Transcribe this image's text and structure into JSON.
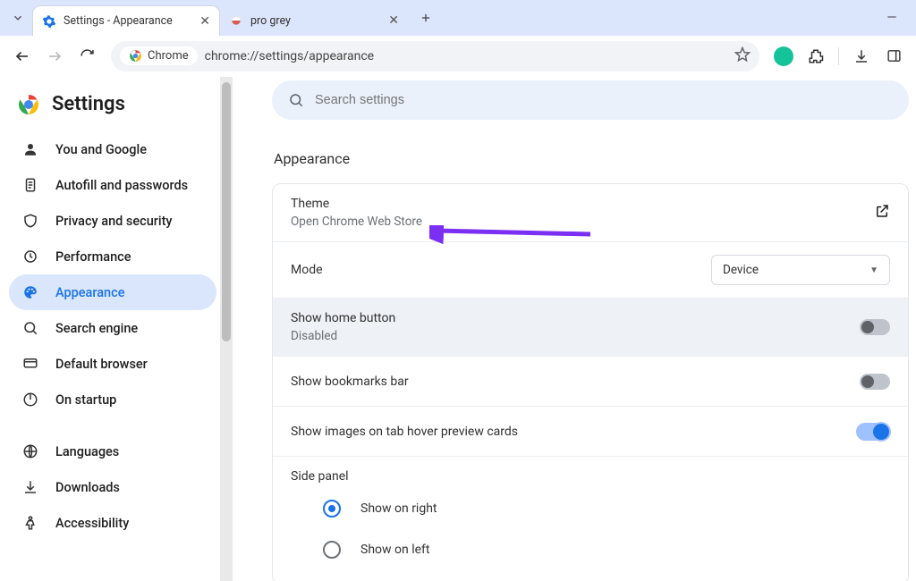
{
  "tabs": [
    {
      "title": "Settings - Appearance",
      "active": true
    },
    {
      "title": "pro grey",
      "active": false
    }
  ],
  "omnibox": {
    "chip_label": "Chrome",
    "url": "chrome://settings/appearance"
  },
  "app_title": "Settings",
  "search_placeholder": "Search settings",
  "sidebar": [
    "You and Google",
    "Autofill and passwords",
    "Privacy and security",
    "Performance",
    "Appearance",
    "Search engine",
    "Default browser",
    "On startup",
    "Languages",
    "Downloads",
    "Accessibility"
  ],
  "sidebar_active_index": 4,
  "section": {
    "heading": "Appearance",
    "theme": {
      "label": "Theme",
      "sub": "Open Chrome Web Store"
    },
    "mode": {
      "label": "Mode",
      "value": "Device"
    },
    "home": {
      "label": "Show home button",
      "sub": "Disabled",
      "on": false
    },
    "bookmarks": {
      "label": "Show bookmarks bar",
      "on": false
    },
    "hover": {
      "label": "Show images on tab hover preview cards",
      "on": true
    },
    "sidepanel": {
      "label": "Side panel",
      "options": [
        "Show on right",
        "Show on left"
      ],
      "selected_index": 0
    }
  }
}
